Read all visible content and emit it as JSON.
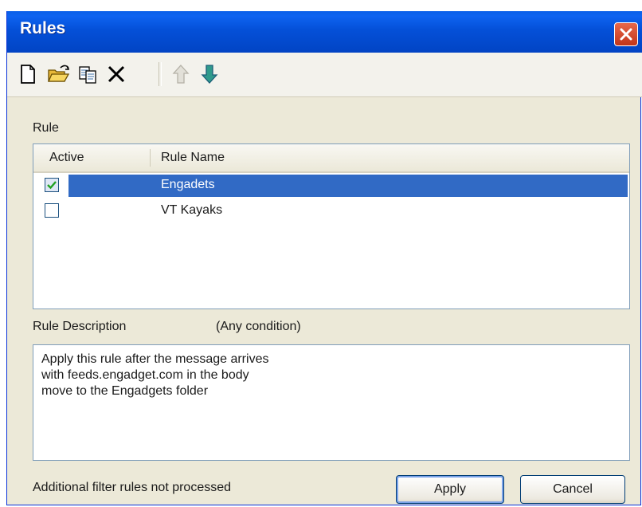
{
  "window": {
    "title": "Rules"
  },
  "toolbar": {
    "buttons": [
      {
        "icon": "new-icon",
        "enabled": true
      },
      {
        "icon": "open-folder-icon",
        "enabled": true
      },
      {
        "icon": "copy-icon",
        "enabled": true
      },
      {
        "icon": "delete-icon",
        "enabled": true
      },
      {
        "icon": "move-up-icon",
        "enabled": false
      },
      {
        "icon": "move-down-icon",
        "enabled": true
      }
    ]
  },
  "rule_section": {
    "label": "Rule",
    "columns": [
      "Active",
      "Rule Name"
    ],
    "rows": [
      {
        "active": true,
        "name": "Engadets",
        "selected": true
      },
      {
        "active": false,
        "name": "VT Kayaks",
        "selected": false
      }
    ]
  },
  "description": {
    "label": "Rule Description",
    "condition": "(Any condition)",
    "lines": [
      "Apply this rule after the message arrives",
      "with feeds.engadget.com in the body",
      "move to the Engadgets folder"
    ]
  },
  "footer": {
    "status": "Additional filter rules not processed",
    "apply_label": "Apply",
    "cancel_label": "Cancel"
  },
  "colors": {
    "titlebar": "#0450d8",
    "selection": "#316ac5",
    "close": "#d6472a"
  }
}
